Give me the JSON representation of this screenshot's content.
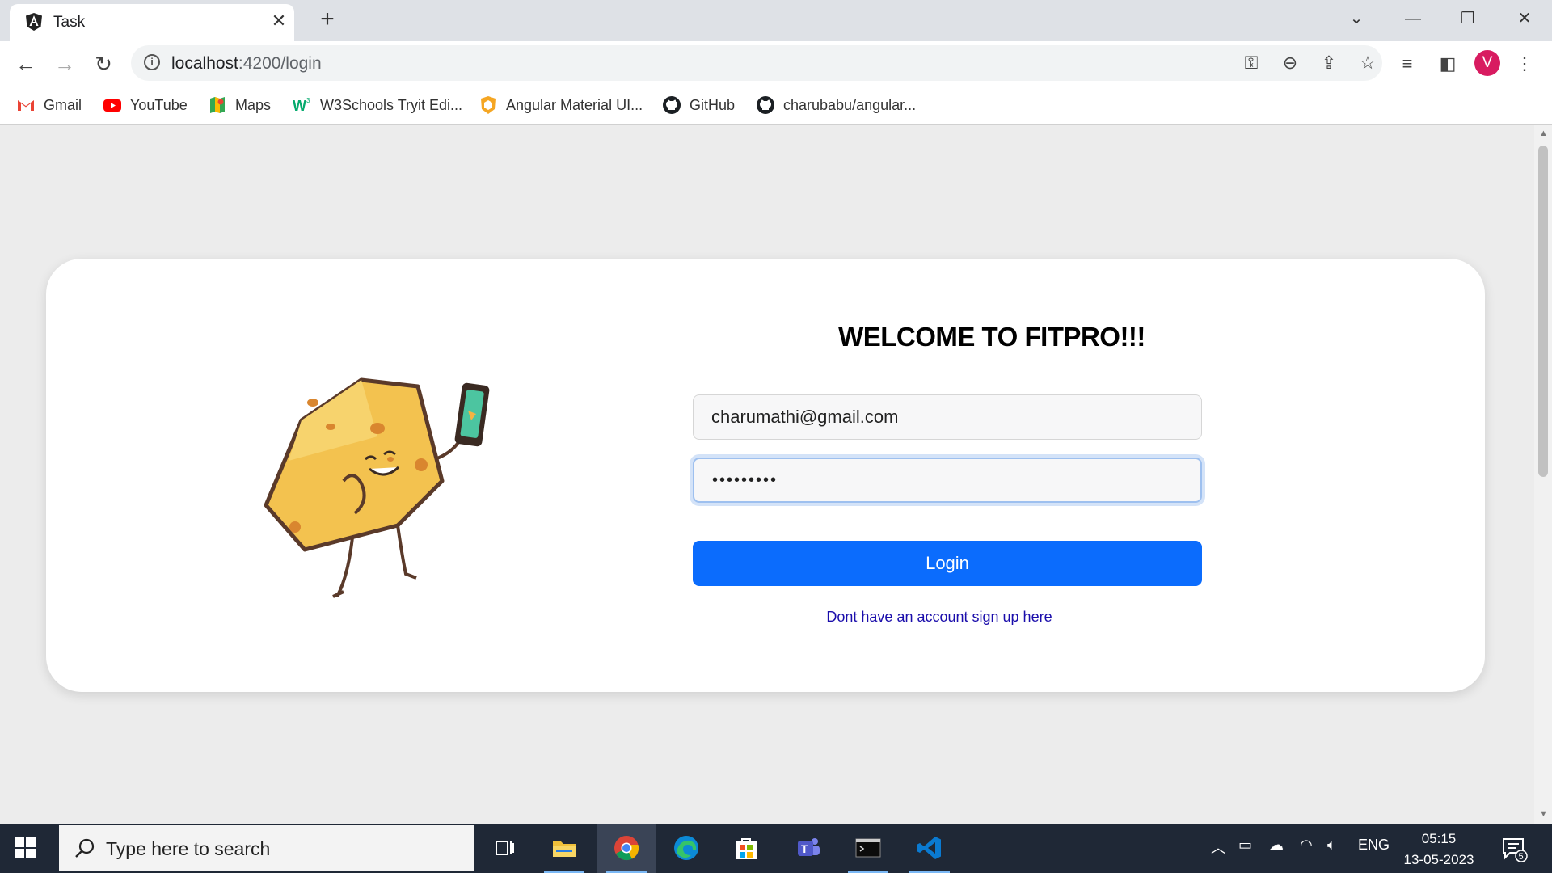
{
  "browser": {
    "tab_title": "Task",
    "url_host": "localhost",
    "url_rest": ":4200/login",
    "profile_initial": "V"
  },
  "bookmarks": [
    {
      "label": "Gmail",
      "icon": "gmail-icon"
    },
    {
      "label": "YouTube",
      "icon": "youtube-icon"
    },
    {
      "label": "Maps",
      "icon": "maps-icon"
    },
    {
      "label": "W3Schools Tryit Edi...",
      "icon": "w3schools-icon"
    },
    {
      "label": "Angular Material UI...",
      "icon": "angular-material-icon"
    },
    {
      "label": "GitHub",
      "icon": "github-icon"
    },
    {
      "label": "charubabu/angular...",
      "icon": "github-icon"
    }
  ],
  "login": {
    "heading": "WELCOME TO FITPRO!!!",
    "email_value": "charumathi@gmail.com",
    "password_masked": "•••••••••",
    "login_label": "Login",
    "signup_text": "Dont have an account sign up here"
  },
  "taskbar": {
    "search_placeholder": "Type here to search",
    "language": "ENG",
    "time": "05:15",
    "date": "13-05-2023",
    "notification_count": "5"
  }
}
